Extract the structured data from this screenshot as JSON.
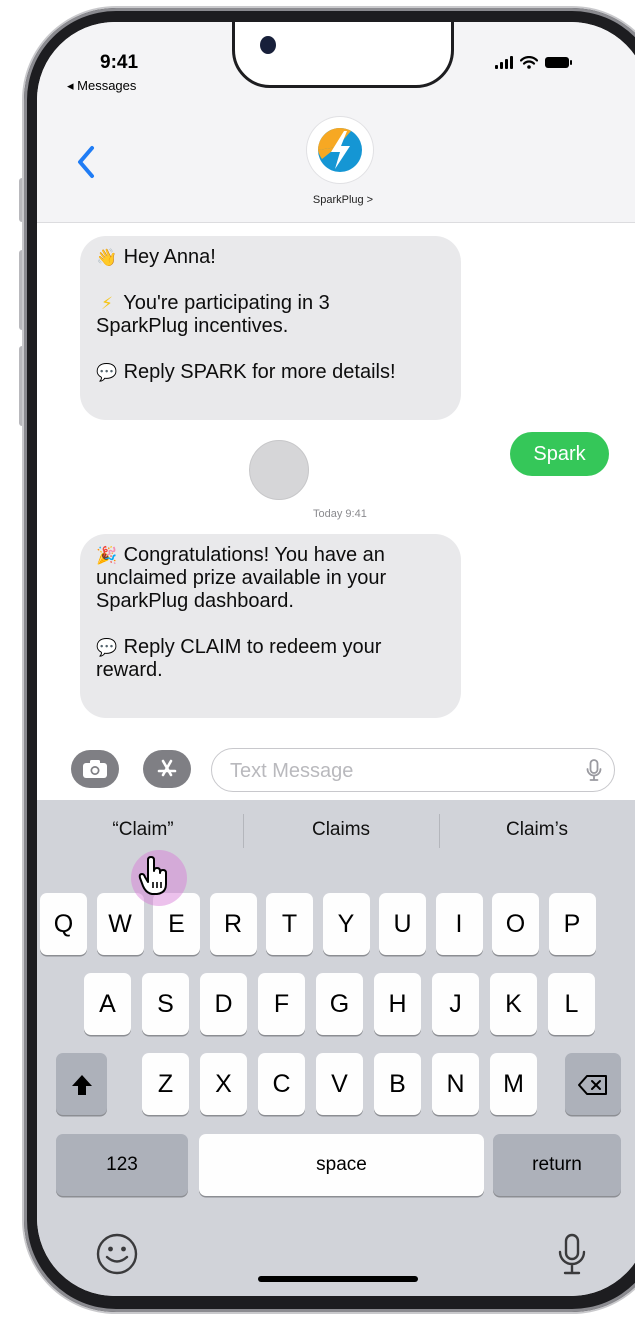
{
  "status_bar": {
    "time": "9:41",
    "back_app": "◂ Messages"
  },
  "header": {
    "contact_name": "SparkPlug >"
  },
  "messages": {
    "first": {
      "greeting": "Hey Anna!",
      "line1": "You're participating in 3",
      "line2": "SparkPlug incentives.",
      "reply": "Reply SPARK for more details!"
    },
    "sent": "Spark",
    "timestamp": "Today 9:41",
    "second": {
      "line1": "Congratulations! You have an",
      "line2": "unclaimed prize available in your",
      "line3": "SparkPlug dashboard.",
      "reply1": "Reply CLAIM to redeem your",
      "reply2": "reward."
    }
  },
  "input": {
    "placeholder": "Text Message"
  },
  "keyboard": {
    "suggestions": [
      "“Claim”",
      "Claims",
      "Claim’s"
    ],
    "row1": [
      "Q",
      "W",
      "E",
      "R",
      "T",
      "Y",
      "U",
      "I",
      "O",
      "P"
    ],
    "row2": [
      "A",
      "S",
      "D",
      "F",
      "G",
      "H",
      "J",
      "K",
      "L"
    ],
    "row3": [
      "Z",
      "X",
      "C",
      "V",
      "B",
      "N",
      "M"
    ],
    "numbers_label": "123",
    "space_label": "space",
    "return_label": "return"
  },
  "colors": {
    "sent_bubble": "#35c759",
    "received_bubble": "#e9e9eb",
    "link_blue": "#1f7cf5",
    "tap_highlight": "#d678d7"
  },
  "icons": [
    "back-chevron-icon",
    "camera-icon",
    "app-store-icon",
    "microphone-icon",
    "shift-icon",
    "delete-icon",
    "emoji-icon",
    "dictation-icon",
    "cursor-hand-icon"
  ]
}
